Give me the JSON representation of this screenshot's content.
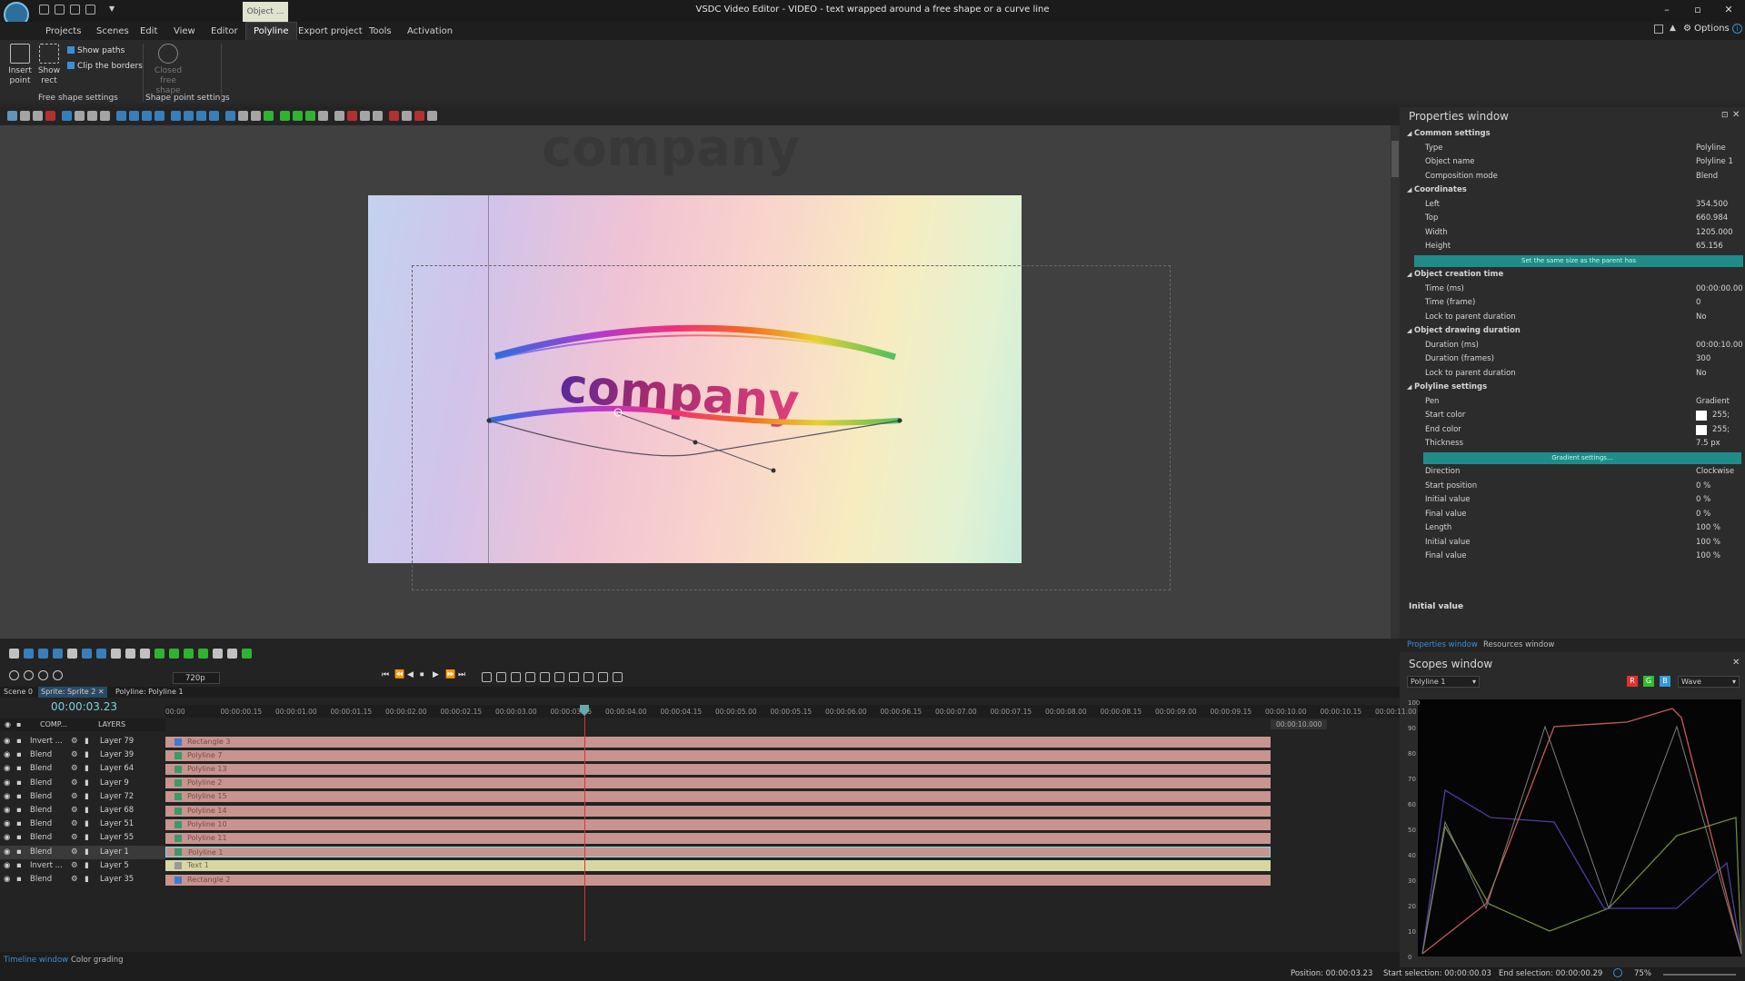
{
  "app": {
    "window_title": "VSDC Video Editor - VIDEO - text wrapped around a free shape or a curve line",
    "object_tab": "Object ...",
    "options_label": "Options"
  },
  "menu": [
    "Projects",
    "Scenes",
    "Edit",
    "View",
    "Editor",
    "Polyline",
    "Export project",
    "Tools",
    "Activation"
  ],
  "ribbon": {
    "insert_point": "Insert point",
    "show_rect": "Show rect",
    "show_paths": "Show paths",
    "clip_borders": "Clip the borders",
    "closed_free_shape": "Closed free shape",
    "group_free_shape": "Free shape settings",
    "group_shape_point": "Shape point settings"
  },
  "canvas": {
    "ghost_text": "company",
    "frame_text": "company"
  },
  "properties": {
    "title": "Properties window",
    "rows": [
      {
        "k": "Common settings",
        "v": "",
        "sec": true
      },
      {
        "k": "Type",
        "v": "Polyline",
        "sec": false
      },
      {
        "k": "Object name",
        "v": "Polyline 1",
        "sec": false
      },
      {
        "k": "Composition mode",
        "v": "Blend",
        "sec": false
      },
      {
        "k": "Coordinates",
        "v": "",
        "sec": true
      },
      {
        "k": "Left",
        "v": "354.500",
        "sec": false
      },
      {
        "k": "Top",
        "v": "660.984",
        "sec": false
      },
      {
        "k": "Width",
        "v": "1205.000",
        "sec": false
      },
      {
        "k": "Height",
        "v": "65.156",
        "sec": false
      },
      {
        "k": "TEAL1",
        "v": "",
        "sec": false
      },
      {
        "k": "Object creation time",
        "v": "",
        "sec": true
      },
      {
        "k": "Time (ms)",
        "v": "00:00:00.00",
        "sec": false
      },
      {
        "k": "Time (frame)",
        "v": "0",
        "sec": false
      },
      {
        "k": "Lock to parent duration",
        "v": "No",
        "sec": false
      },
      {
        "k": "Object drawing duration",
        "v": "",
        "sec": true
      },
      {
        "k": "Duration (ms)",
        "v": "00:00:10.00",
        "sec": false
      },
      {
        "k": "Duration (frames)",
        "v": "300",
        "sec": false
      },
      {
        "k": "Lock to parent duration",
        "v": "No",
        "sec": false
      },
      {
        "k": "Polyline settings",
        "v": "",
        "sec": true
      },
      {
        "k": "Pen",
        "v": "Gradient",
        "sec": false
      },
      {
        "k": "Start color",
        "v": "255; ",
        "sec": false
      },
      {
        "k": "End color",
        "v": "255; ",
        "sec": false
      },
      {
        "k": "Thickness",
        "v": "7.5 px",
        "sec": false
      },
      {
        "k": "TEAL2",
        "v": "",
        "sec": false
      },
      {
        "k": "Direction",
        "v": "Clockwise",
        "sec": false
      },
      {
        "k": "Start position",
        "v": "0 %",
        "sec": false
      },
      {
        "k": "Initial value",
        "v": "0 %",
        "sec": false
      },
      {
        "k": "Final value",
        "v": "0 %",
        "sec": false
      },
      {
        "k": "Length",
        "v": "100 %",
        "sec": false
      },
      {
        "k": "Initial value",
        "v": "100 %",
        "sec": false
      },
      {
        "k": "Final value",
        "v": "100 %",
        "sec": false
      }
    ],
    "teal1": "Set the same size as the parent has",
    "teal2": "Gradient settings...",
    "footer_label": "Initial value",
    "tab_properties": "Properties window",
    "tab_resources": "Resources window"
  },
  "scopes": {
    "title": "Scopes window",
    "object_select": "Polyline 1",
    "mode": "Wave",
    "btn_r": "R",
    "btn_g": "G",
    "btn_b": "B",
    "yticks": [
      "100",
      "90",
      "80",
      "70",
      "60",
      "50",
      "40",
      "30",
      "20",
      "10",
      "0"
    ]
  },
  "timeline": {
    "tab_scene": "Scene 0",
    "tab_sprite": "Sprite: Sprite 2",
    "tab_polyline": "Polyline: Polyline 1",
    "current_time": "00:00:03.23",
    "resolution": "720p",
    "header_comp": "COMP...",
    "header_layers": "LAYERS",
    "ruler": [
      "00:00",
      "00:00:00.15",
      "00:00:01.00",
      "00:00:01.15",
      "00:00:02.00",
      "00:00:02.15",
      "00:00:03.00",
      "00:00:03.15",
      "00:00:04.00",
      "00:00:04.15",
      "00:00:05.00",
      "00:00:05.15",
      "00:00:06.00",
      "00:00:06.15",
      "00:00:07.00",
      "00:00:07.15",
      "00:00:08.00",
      "00:00:08.15",
      "00:00:09.00",
      "00:00:09.15",
      "00:00:10.00",
      "00:00:10.15",
      "00:00:11.00"
    ],
    "end_marker": "00:00:10.000",
    "rows": [
      {
        "blend": "Invert ...",
        "layer": "Layer 79",
        "clip": "Rectangle 3",
        "kind": "rect"
      },
      {
        "blend": "Blend",
        "layer": "Layer 39",
        "clip": "Polyline 7",
        "kind": "poly"
      },
      {
        "blend": "Blend",
        "layer": "Layer 64",
        "clip": "Polyline 13",
        "kind": "poly"
      },
      {
        "blend": "Blend",
        "layer": "Layer 9",
        "clip": "Polyline 2",
        "kind": "poly"
      },
      {
        "blend": "Blend",
        "layer": "Layer 72",
        "clip": "Polyline 15",
        "kind": "poly"
      },
      {
        "blend": "Blend",
        "layer": "Layer 68",
        "clip": "Polyline 14",
        "kind": "poly"
      },
      {
        "blend": "Blend",
        "layer": "Layer 51",
        "clip": "Polyline 10",
        "kind": "poly"
      },
      {
        "blend": "Blend",
        "layer": "Layer 55",
        "clip": "Polyline 11",
        "kind": "poly"
      },
      {
        "blend": "Blend",
        "layer": "Layer 1",
        "clip": "Polyline 1",
        "kind": "poly"
      },
      {
        "blend": "Invert ...",
        "layer": "Layer 5",
        "clip": "Text 1",
        "kind": "text"
      },
      {
        "blend": "Blend",
        "layer": "Layer 35",
        "clip": "Rectangle 2",
        "kind": "rect"
      }
    ],
    "bottom_tab_timeline": "Timeline window",
    "bottom_tab_color": "Color grading"
  },
  "status": {
    "position_label": "Position:",
    "position": "00:00:03.23",
    "start_label": "Start selection:",
    "start": "00:00:00.03",
    "end_label": "End selection:",
    "end": "00:00:00.29",
    "zoom": "75%"
  }
}
